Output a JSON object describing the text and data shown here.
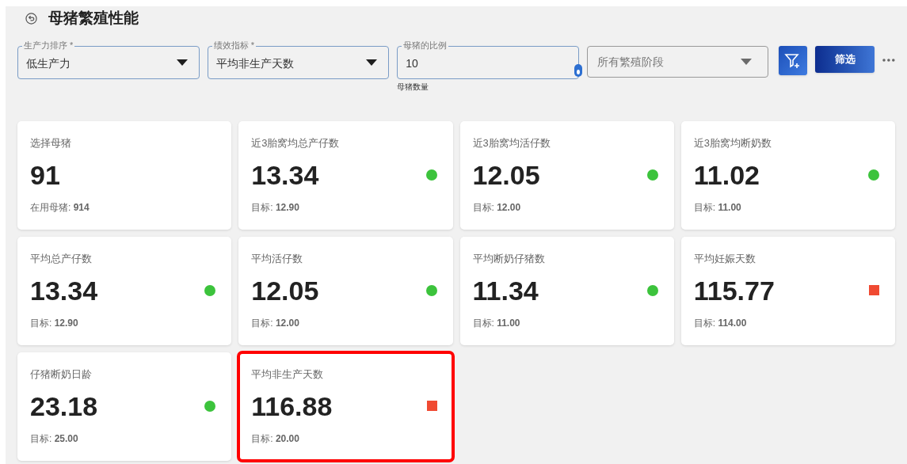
{
  "title": "母猪繁殖性能",
  "filters": [
    {
      "kind": "select",
      "label": "生产力排序 *",
      "value": "低生产力"
    },
    {
      "kind": "select",
      "label": "绩效指标 *",
      "value": "平均非生产天数"
    },
    {
      "kind": "input",
      "label": "母猪的比例",
      "value": "10",
      "helper": "母猪数量"
    },
    {
      "kind": "select_empty",
      "placeholder": "所有繁殖阶段"
    }
  ],
  "filter_button": "筛选",
  "cards": [
    {
      "label": "选择母猪",
      "value": "91",
      "sub": "在用母猪: **914**",
      "kind": "plain",
      "highlighted": false
    },
    {
      "label": "近3胎窝均总产仔数",
      "value": "13.34",
      "sub": "目标: **12.90**",
      "kind": "on_target",
      "highlighted": false
    },
    {
      "label": "近3胎窝均活仔数",
      "value": "12.05",
      "sub": "目标: **12.00**",
      "kind": "on_target",
      "highlighted": false
    },
    {
      "label": "近3胎窝均断奶数",
      "value": "11.02",
      "sub": "目标: **11.00**",
      "kind": "on_target",
      "highlighted": false
    },
    {
      "label": "平均总产仔数",
      "value": "13.34",
      "sub": "目标: **12.90**",
      "kind": "on_target",
      "highlighted": false
    },
    {
      "label": "平均活仔数",
      "value": "12.05",
      "sub": "目标: **12.00**",
      "kind": "on_target",
      "highlighted": false
    },
    {
      "label": "平均断奶仔猪数",
      "value": "11.34",
      "sub": "目标: **11.00**",
      "kind": "on_target",
      "highlighted": false
    },
    {
      "label": "平均妊娠天数",
      "value": "115.77",
      "sub": "目标: **114.00**",
      "kind": "off_target",
      "highlighted": false
    },
    {
      "label": "仔猪断奶日龄",
      "value": "23.18",
      "sub": "目标: **25.00**",
      "kind": "on_target",
      "highlighted": false
    },
    {
      "label": "平均非生产天数",
      "value": "116.88",
      "sub": "目标: **20.00**",
      "kind": "off_target",
      "highlighted": true
    }
  ]
}
